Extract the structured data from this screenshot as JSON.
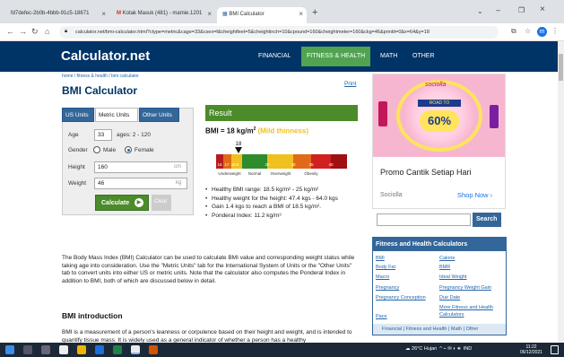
{
  "browser": {
    "tabs": [
      {
        "label": "fd7defec-2b0b-4bbb-91c5-18671"
      },
      {
        "label": "Kotak Masuk (481) - mamie.1201"
      },
      {
        "label": "BMI Calculator"
      }
    ],
    "new_tab": "+",
    "url": "calculator.net/bmi-calculator.html?ctype=metric&cage=33&csex=f&cheightfeet=5&cheightinch=10&cpound=160&cheightmeter=160&ckg=46&printit=0&x=64&y=18",
    "profile_initial": "m"
  },
  "site": {
    "logo": "Calculator.net",
    "nav": [
      "FINANCIAL",
      "FITNESS & HEALTH",
      "MATH",
      "OTHER"
    ]
  },
  "page": {
    "breadcrumb": "home / fitness & health / bmi calculator",
    "print": "Print",
    "title": "BMI Calculator"
  },
  "form": {
    "tabs": [
      "US Units",
      "Metric Units",
      "Other Units"
    ],
    "age_label": "Age",
    "age_value": "33",
    "age_hint": "ages: 2 - 120",
    "gender_label": "Gender",
    "gender_male": "Male",
    "gender_female": "Female",
    "height_label": "Height",
    "height_value": "160",
    "height_unit": "cm",
    "weight_label": "Weight",
    "weight_value": "46",
    "weight_unit": "kg",
    "calculate": "Calculate",
    "clear": "Clear"
  },
  "result": {
    "header": "Result",
    "bmi_prefix": "BMI = 18 kg/m",
    "bmi_sup": "2",
    "category": "(Mild thinness)",
    "gauge_value": 18,
    "gauge_value_label": "18",
    "gauge_ticks": [
      "16",
      "17",
      "18.5",
      "25",
      "30",
      "35",
      "40"
    ],
    "gauge_labels": [
      "Underweight",
      "Normal",
      "Overweight",
      "Obesity"
    ],
    "bullets": [
      "Healthy BMI range: 18.5 kg/m² - 25 kg/m²",
      "Healthy weight for the height: 47.4 kgs - 64.0 kgs",
      "Gain 1.4 kgs to reach a BMI of 18.5 kg/m².",
      "Ponderal Index: 11.2 kg/m³"
    ]
  },
  "article": {
    "para1": "The Body Mass Index (BMI) Calculator can be used to calculate BMI value and corresponding weight status while taking age into consideration. Use the \"Metric Units\" tab for the International System of Units or the \"Other Units\" tab to convert units into either US or metric units. Note that the calculator also computes the Ponderal Index in addition to BMI, both of which are discussed below in detail.",
    "h2": "BMI introduction",
    "para2": "BMI is a measurement of a person's leanness or corpulence based on their height and weight, and is intended to quantify tissue mass. It is widely used as a general indicator of whether a person has a healthy"
  },
  "ad": {
    "brand_logo": "sociolla",
    "ribbon": "ROAD TO",
    "percent": "60%",
    "title": "Promo Cantik Setiap Hari",
    "brand": "Sociolla",
    "shop": "Shop Now ›"
  },
  "sidebar": {
    "search_button": "Search",
    "fh_title": "Fitness and Health Calculators",
    "links_left": [
      "BMI",
      "Body Fat",
      "Macro",
      "Pregnancy",
      "Pregnancy Conception",
      "Pace"
    ],
    "links_right": [
      "Calorie",
      "BMR",
      "Ideal Weight",
      "Pregnancy Weight Gain",
      "Due Date",
      "More Fitness and Health",
      "Calculators"
    ],
    "footer_links": [
      "Financial",
      "Fitness and Health",
      "Math",
      "Other"
    ]
  },
  "taskbar": {
    "weather": "26°C  Hujan",
    "lang": "IND",
    "time": "11:22",
    "date": "06/12/2021"
  },
  "colors": {
    "header": "#003366",
    "green": "#4b8b2a",
    "link": "#2266aa",
    "tab_blue": "#336699"
  }
}
